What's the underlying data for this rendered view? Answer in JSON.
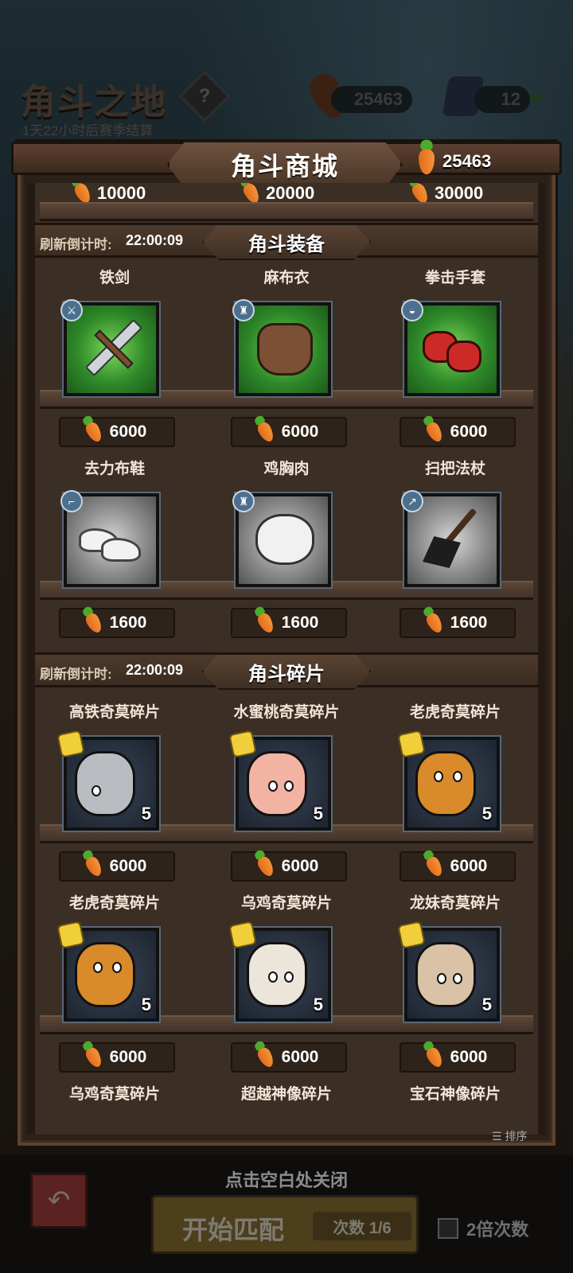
{
  "hud": {
    "title": "角斗之地",
    "help_glyph": "?",
    "season_countdown": "1天22小时后赛季结算",
    "carrots": "25463",
    "gems": "12",
    "plus_glyph": "+"
  },
  "modal": {
    "title": "角斗商城",
    "currency_value": "25463"
  },
  "top_partial_prices": [
    "10000",
    "20000",
    "30000"
  ],
  "sections": [
    {
      "refresh_label": "刷新倒计时:",
      "refresh_time": "22:00:09",
      "title": "角斗装备",
      "rows": [
        [
          {
            "name": "铁剑",
            "price": "6000",
            "frame": "green",
            "badge_icon": "sword-icon",
            "badge_glyph": "⚔"
          },
          {
            "name": "麻布衣",
            "price": "6000",
            "frame": "green",
            "badge_icon": "armor-icon",
            "badge_glyph": "♜"
          },
          {
            "name": "拳击手套",
            "price": "6000",
            "frame": "green",
            "badge_icon": "helmet-icon",
            "badge_glyph": "◒"
          }
        ],
        [
          {
            "name": "去力布鞋",
            "price": "1600",
            "frame": "grey",
            "badge_icon": "boot-icon",
            "badge_glyph": "⌐"
          },
          {
            "name": "鸡胸肉",
            "price": "1600",
            "frame": "grey",
            "badge_icon": "armor-icon",
            "badge_glyph": "♜"
          },
          {
            "name": "扫把法杖",
            "price": "1600",
            "frame": "grey",
            "badge_icon": "staff-icon",
            "badge_glyph": "↗"
          }
        ]
      ]
    },
    {
      "refresh_label": "刷新倒计时:",
      "refresh_time": "22:00:09",
      "title": "角斗碎片",
      "rows": [
        [
          {
            "name": "高铁奇莫碎片",
            "price": "6000",
            "count": "5"
          },
          {
            "name": "水蜜桃奇莫碎片",
            "price": "6000",
            "count": "5"
          },
          {
            "name": "老虎奇莫碎片",
            "price": "6000",
            "count": "5"
          }
        ],
        [
          {
            "name": "老虎奇莫碎片",
            "price": "6000",
            "count": "5"
          },
          {
            "name": "乌鸡奇莫碎片",
            "price": "6000",
            "count": "5"
          },
          {
            "name": "龙妹奇莫碎片",
            "price": "6000",
            "count": "5"
          }
        ]
      ]
    }
  ],
  "bottom_partial_names": [
    "乌鸡奇莫碎片",
    "超越神像碎片",
    "宝石神像碎片"
  ],
  "sort_label": "排序",
  "bottom": {
    "close_hint": "点击空白处关闭",
    "match_label": "开始匹配",
    "match_count": "次数 1/6",
    "double_label": "2倍次数"
  },
  "colors": {
    "carrot": "#e36a1c",
    "frame_green": "#2f8a2a",
    "frame_grey": "#8b8b8b",
    "puzzle": "#f1cf3a"
  }
}
